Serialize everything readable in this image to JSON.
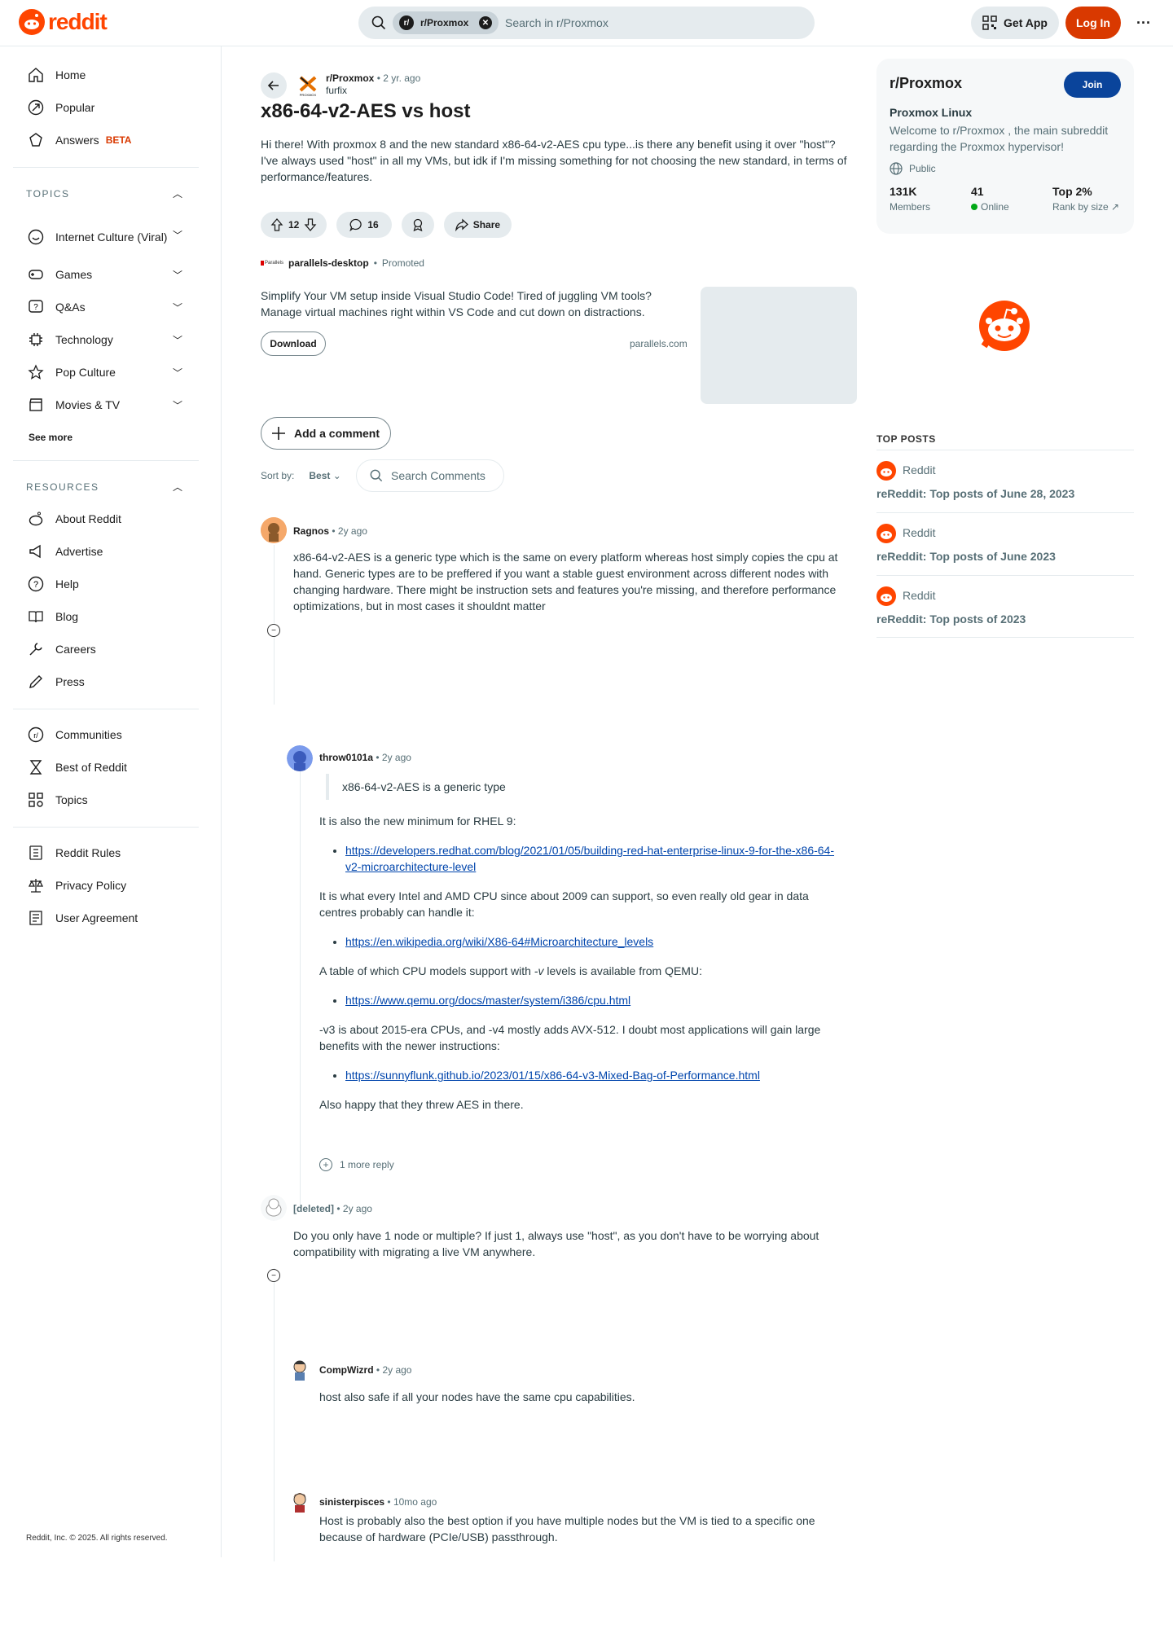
{
  "header": {
    "logo_text": "reddit",
    "search_chip": "r/Proxmox",
    "search_placeholder": "Search in r/Proxmox",
    "get_app": "Get App",
    "login": "Log In"
  },
  "sidebar": {
    "nav": [
      {
        "label": "Home",
        "icon": "home-icon"
      },
      {
        "label": "Popular",
        "icon": "popular-icon"
      },
      {
        "label": "Answers",
        "icon": "answers-icon",
        "badge": "BETA"
      }
    ],
    "topics_title": "TOPICS",
    "topics": [
      {
        "label": "Internet Culture (Viral)",
        "icon": "smile-icon"
      },
      {
        "label": "Games",
        "icon": "gamepad-icon"
      },
      {
        "label": "Q&As",
        "icon": "question-icon"
      },
      {
        "label": "Technology",
        "icon": "chip-icon"
      },
      {
        "label": "Pop Culture",
        "icon": "star-icon"
      },
      {
        "label": "Movies & TV",
        "icon": "clapper-icon"
      }
    ],
    "see_more": "See more",
    "resources_title": "RESOURCES",
    "resources": [
      {
        "label": "About Reddit"
      },
      {
        "label": "Advertise"
      },
      {
        "label": "Help"
      },
      {
        "label": "Blog"
      },
      {
        "label": "Careers"
      },
      {
        "label": "Press"
      }
    ],
    "community_links": [
      {
        "label": "Communities"
      },
      {
        "label": "Best of Reddit"
      },
      {
        "label": "Topics"
      }
    ],
    "legal": [
      {
        "label": "Reddit Rules"
      },
      {
        "label": "Privacy Policy"
      },
      {
        "label": "User Agreement"
      }
    ],
    "copyright": "Reddit, Inc. © 2025. All rights reserved."
  },
  "post": {
    "subreddit": "r/Proxmox",
    "age": "2 yr. ago",
    "author": "furfix",
    "title": "x86-64-v2-AES vs host",
    "body": "Hi there! With proxmox 8 and the new standard x86-64-v2-AES cpu type...is there any benefit using it over \"host\"? I've always used \"host\" in all my VMs, but idk if I'm missing something for not choosing the new standard, in terms of performance/features.",
    "votes": "12",
    "comments": "16",
    "share": "Share"
  },
  "ad": {
    "advertiser": "parallels-desktop",
    "promoted": "Promoted",
    "body": "Simplify Your VM setup inside Visual Studio Code! Tired of juggling VM tools? Manage virtual machines right within VS Code and cut down on distractions.",
    "button": "Download",
    "domain": "parallels.com"
  },
  "comments_bar": {
    "add_comment": "Add a comment",
    "sort_label": "Sort by:",
    "sort_value": "Best",
    "search_placeholder": "Search Comments"
  },
  "comments": [
    {
      "author": "Ragnos",
      "age": "2y ago",
      "text": "x86-64-v2-AES is a generic type which is the same on every platform whereas host simply copies the cpu at hand. Generic types are to be preffered if you want a stable guest environment across different nodes with changing hardware. There might be instruction sets and features you're missing, and therefore performance optimizations, but in most cases it shouldnt matter"
    },
    {
      "author": "throw0101a",
      "age": "2y ago",
      "quote": "x86-64-v2-AES is a generic type",
      "p1": "It is also the new minimum for RHEL 9:",
      "l1": "https://developers.redhat.com/blog/2021/01/05/building-red-hat-enterprise-linux-9-for-the-x86-64-v2-microarchitecture-level",
      "p2": "It is what every Intel and AMD CPU since about 2009 can support, so even really old gear in data centres probably can handle it:",
      "l2": "https://en.wikipedia.org/wiki/X86-64#Microarchitecture_levels",
      "p3a": "A table of which CPU models support with ",
      "p3b": "-v",
      "p3c": " levels is available from QEMU:",
      "l3": "https://www.qemu.org/docs/master/system/i386/cpu.html",
      "p4": "-v3 is about 2015-era CPUs, and -v4 mostly adds AVX-512. I doubt most applications will gain large benefits with the newer instructions:",
      "l4": "https://sunnyflunk.github.io/2023/01/15/x86-64-v3-Mixed-Bag-of-Performance.html",
      "p5": "Also happy that they threw AES in there.",
      "more_replies": "1 more reply"
    },
    {
      "author": "[deleted]",
      "age": "2y ago",
      "text": "Do you only have 1 node or multiple? If just 1, always use \"host\", as you don't have to be worrying about compatibility with migrating a live VM anywhere."
    },
    {
      "author": "CompWizrd",
      "age": "2y ago",
      "text": "host also safe if all your nodes have the same cpu capabilities."
    },
    {
      "author": "sinisterpisces",
      "age": "10mo ago",
      "text": "Host is probably also the best option if you have multiple nodes but the VM is tied to a specific one because of hardware (PCIe/USB) passthrough."
    }
  ],
  "community": {
    "name": "r/Proxmox",
    "join": "Join",
    "title": "Proxmox Linux",
    "description": "Welcome to r/Proxmox , the main subreddit regarding the Proxmox hypervisor!",
    "visibility": "Public",
    "members": "131K",
    "members_label": "Members",
    "online": "41",
    "online_label": "Online",
    "rank": "Top 2%",
    "rank_label": "Rank by size"
  },
  "top_posts": {
    "title": "TOP POSTS",
    "items": [
      {
        "source": "Reddit",
        "title": "reReddit: Top posts of June 28, 2023"
      },
      {
        "source": "Reddit",
        "title": "reReddit: Top posts of June 2023"
      },
      {
        "source": "Reddit",
        "title": "reReddit: Top posts of 2023"
      }
    ]
  },
  "colors": {
    "accent": "#ff4500",
    "login": "#d93900",
    "join": "#0a449b",
    "link": "#0045ac"
  }
}
